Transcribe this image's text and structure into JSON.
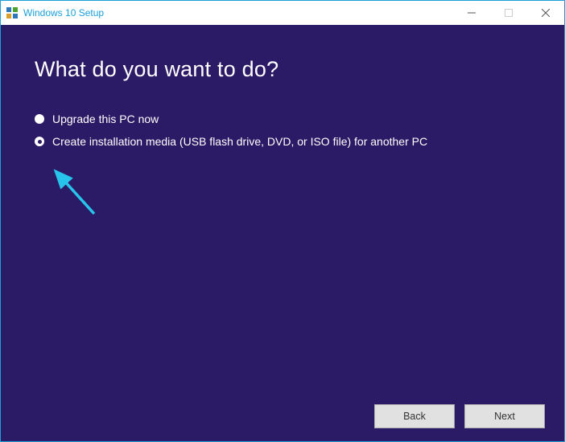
{
  "window": {
    "title": "Windows 10 Setup"
  },
  "content": {
    "heading": "What do you want to do?",
    "options": [
      {
        "label": "Upgrade this PC now",
        "selected": false
      },
      {
        "label": "Create installation media (USB flash drive, DVD, or ISO file) for another PC",
        "selected": true
      }
    ]
  },
  "footer": {
    "back": "Back",
    "next": "Next"
  },
  "colors": {
    "accent": "#1a9fd9",
    "contentBg": "#2b1a66",
    "arrow": "#28c3eb"
  }
}
